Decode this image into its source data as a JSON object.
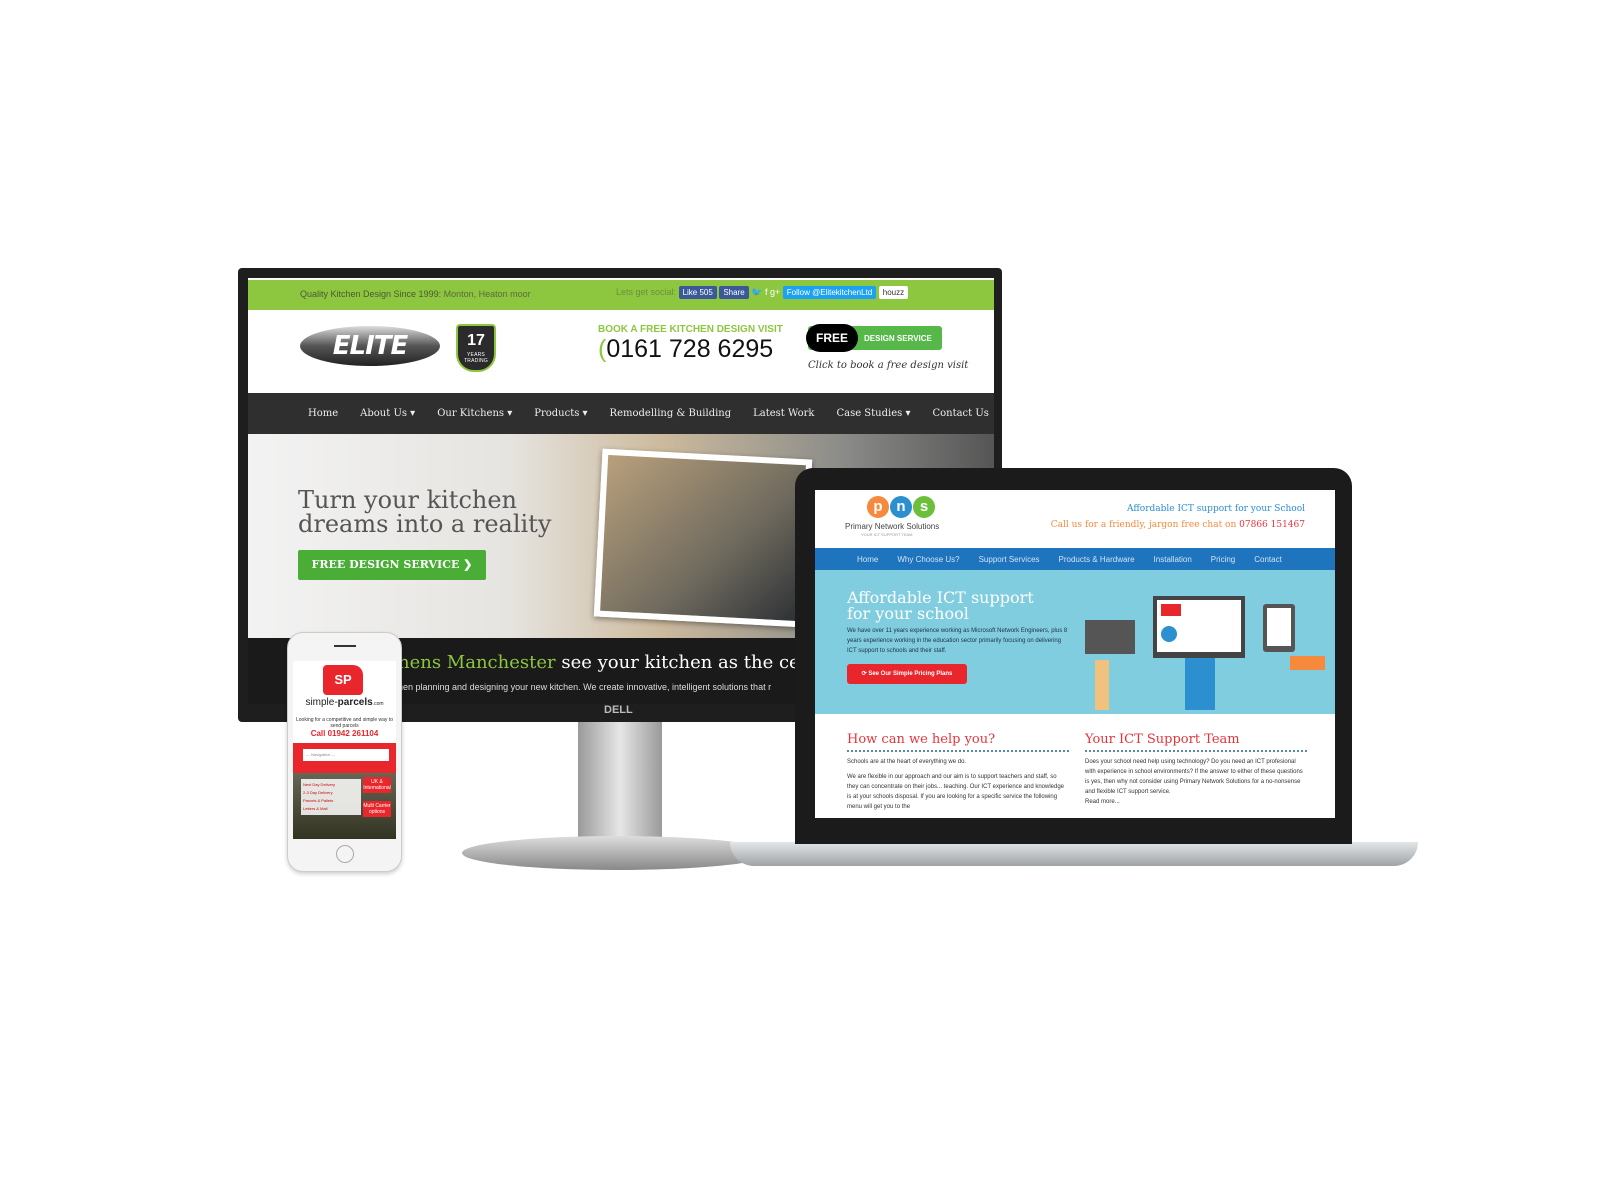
{
  "elite": {
    "tagline": "Quality Kitchen Design Since 1999:",
    "location": "Monton, Heaton moor",
    "social_label": "Lets get social:",
    "like": "Like 505",
    "share": "Share",
    "follow": "Follow @ElitekitchenLtd",
    "houzz": "houzz",
    "logo": "ELITE Kitchens",
    "badge": "17",
    "badge_sub": "YEARS TRADING",
    "book": "BOOK A FREE KITCHEN DESIGN VISIT",
    "phone": "0161 728 6295",
    "free": "FREE",
    "design_service": "DESIGN SERVICE",
    "click_note": "Click to book a free design visit",
    "nav": [
      "Home",
      "About Us ▾",
      "Our Kitchens ▾",
      "Products ▾",
      "Remodelling & Building",
      "Latest Work",
      "Case Studies ▾",
      "Contact Us"
    ],
    "hero_line1": "Turn your kitchen",
    "hero_line2": "dreams into a reality",
    "hero_button": "FREE DESIGN SERVICE ❯",
    "band_green": "hens Manchester",
    "band_white": " see your kitchen as the centre",
    "band_text": "hen planning and designing your new kitchen. We create innovative, intelligent solutions that r",
    "brand_color": "#8dc63f"
  },
  "monitor_brand": "DELL",
  "pns": {
    "logo_letters": [
      "p",
      "n",
      "s"
    ],
    "name": "Primary Network Solutions",
    "tag": "YOUR ICT SUPPORT TEAM",
    "right1": "Affordable ICT support for your School",
    "right2": "Call us for a friendly, jargon free chat on ",
    "phone": "07866 151467",
    "nav": [
      "Home",
      "Why Choose Us?",
      "Support Services",
      "Products & Hardware",
      "Installation",
      "Pricing",
      "Contact"
    ],
    "hero_line1": "Affordable ICT support",
    "hero_line2": "for your school",
    "hero_text": "We have over 11 years experience working as Microsoft Network Engineers, plus 8 years experience working in the education sector primarily focusing on delivering ICT support to schools and their staff.",
    "hero_button": "⟳ See Our Simple Pricing Plans",
    "col1_title": "How can we help you?",
    "col1_p1": "Schools are at the heart of everything we do.",
    "col1_p2": "We are flexible in our approach and our aim is to support teachers and staff, so they can concentrate on their jobs... teaching. Our ICT experience and knowledge is at your schools disposal. If you are looking for a specific service the following menu will get you to the",
    "col2_title": "Your ICT Support Team",
    "col2_p": "Does your school need help using technology? Do you need an ICT profesional with experience in school environments? If the answer to either of these questions is yes, then why not consider using Primary Network Solutions for a no-nonsense and flexible ICT support service.",
    "read_more": "Read more...",
    "nav_color": "#1f74be",
    "hero_color": "#80cde0"
  },
  "sp": {
    "logo": "SP",
    "name_light": "simple-",
    "name_bold": "parcels",
    "name_suffix": ".com",
    "sub": "Looking for a competitive and simple way to send parcels",
    "call": "Call 01942 261104",
    "nav_select": "--- Navigation ---",
    "list": [
      "Next Day Delivery",
      "2-3 Day Delivery",
      "Parcels & Pallets",
      "Letters & Mail"
    ],
    "tag1": "UK & International",
    "tag2": "Multi Carrier options",
    "accent": "#e8262c"
  }
}
